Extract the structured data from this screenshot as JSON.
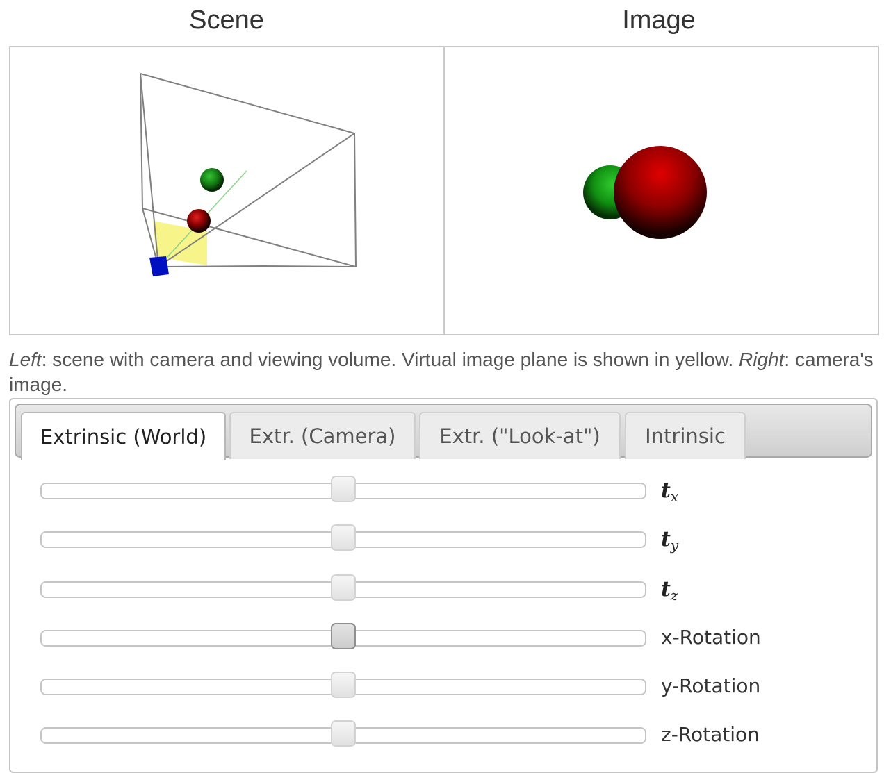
{
  "headings": {
    "scene": "Scene",
    "image": "Image"
  },
  "caption": {
    "left_word": "Left",
    "left_text": ": scene with camera and viewing volume. Virtual image plane is shown in yellow. ",
    "right_word": "Right",
    "right_text": ": camera's image."
  },
  "tabs": [
    {
      "label": "Extrinsic (World)",
      "active": true
    },
    {
      "label": "Extr. (Camera)",
      "active": false
    },
    {
      "label": "Extr. (\"Look-at\")",
      "active": false
    },
    {
      "label": "Intrinsic",
      "active": false
    }
  ],
  "sliders": [
    {
      "symbol": "t",
      "subscript": "x",
      "value_fraction": 0.5
    },
    {
      "symbol": "t",
      "subscript": "y",
      "value_fraction": 0.5
    },
    {
      "symbol": "t",
      "subscript": "z",
      "value_fraction": 0.5
    },
    {
      "label": "x-Rotation",
      "value_fraction": 0.5,
      "focused": true
    },
    {
      "label": "y-Rotation",
      "value_fraction": 0.5
    },
    {
      "label": "z-Rotation",
      "value_fraction": 0.5
    }
  ],
  "colors": {
    "image_plane": "#f7f48a",
    "camera": "#0010c0",
    "sphere_red": "#b00000",
    "sphere_green": "#1a9a1a",
    "frustum_line": "#808080"
  }
}
